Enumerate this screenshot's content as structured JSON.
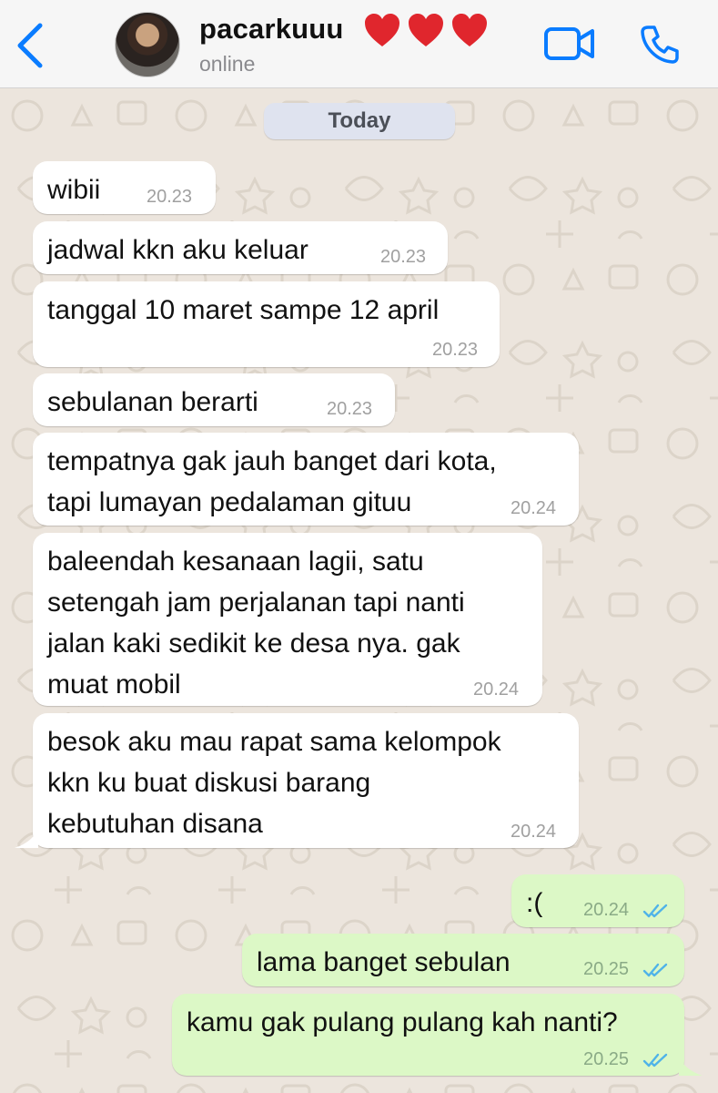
{
  "header": {
    "back_icon": "chevron-left-icon",
    "contact_name": "pacarkuuu",
    "hearts": [
      "❤️",
      "❤️",
      "❤️"
    ],
    "status": "online",
    "video_icon": "video-camera-icon",
    "call_icon": "phone-icon",
    "accent_color": "#0a7cff"
  },
  "chat": {
    "date_label": "Today",
    "messages": [
      {
        "direction": "in",
        "text": "wibii",
        "time": "20.23"
      },
      {
        "direction": "in",
        "text": "jadwal kkn aku keluar",
        "time": "20.23"
      },
      {
        "direction": "in",
        "text": "tanggal 10 maret sampe 12 april",
        "time": "20.23"
      },
      {
        "direction": "in",
        "text": "sebulanan berarti",
        "time": "20.23"
      },
      {
        "direction": "in",
        "text": "tempatnya gak jauh banget dari kota,\ntapi lumayan pedalaman gituu",
        "time": "20.24"
      },
      {
        "direction": "in",
        "text": "baleendah kesanaan lagii, satu\nsetengah jam perjalanan tapi nanti\njalan kaki sedikit ke desa nya. gak\nmuat mobil",
        "time": "20.24"
      },
      {
        "direction": "in",
        "text": "besok aku mau rapat sama kelompok\nkkn ku buat diskusi barang\nkebutuhan disana",
        "time": "20.24"
      },
      {
        "direction": "out",
        "text": ":(",
        "time": "20.24",
        "status": "read"
      },
      {
        "direction": "out",
        "text": "lama banget sebulan",
        "time": "20.25",
        "status": "read"
      },
      {
        "direction": "out",
        "text": "kamu gak pulang pulang kah nanti?",
        "time": "20.25",
        "status": "read"
      }
    ],
    "colors": {
      "incoming_bubble": "#ffffff",
      "outgoing_bubble": "#dcf8c6",
      "read_ticks": "#4fb3e8",
      "wallpaper": "#ece5dd"
    }
  }
}
